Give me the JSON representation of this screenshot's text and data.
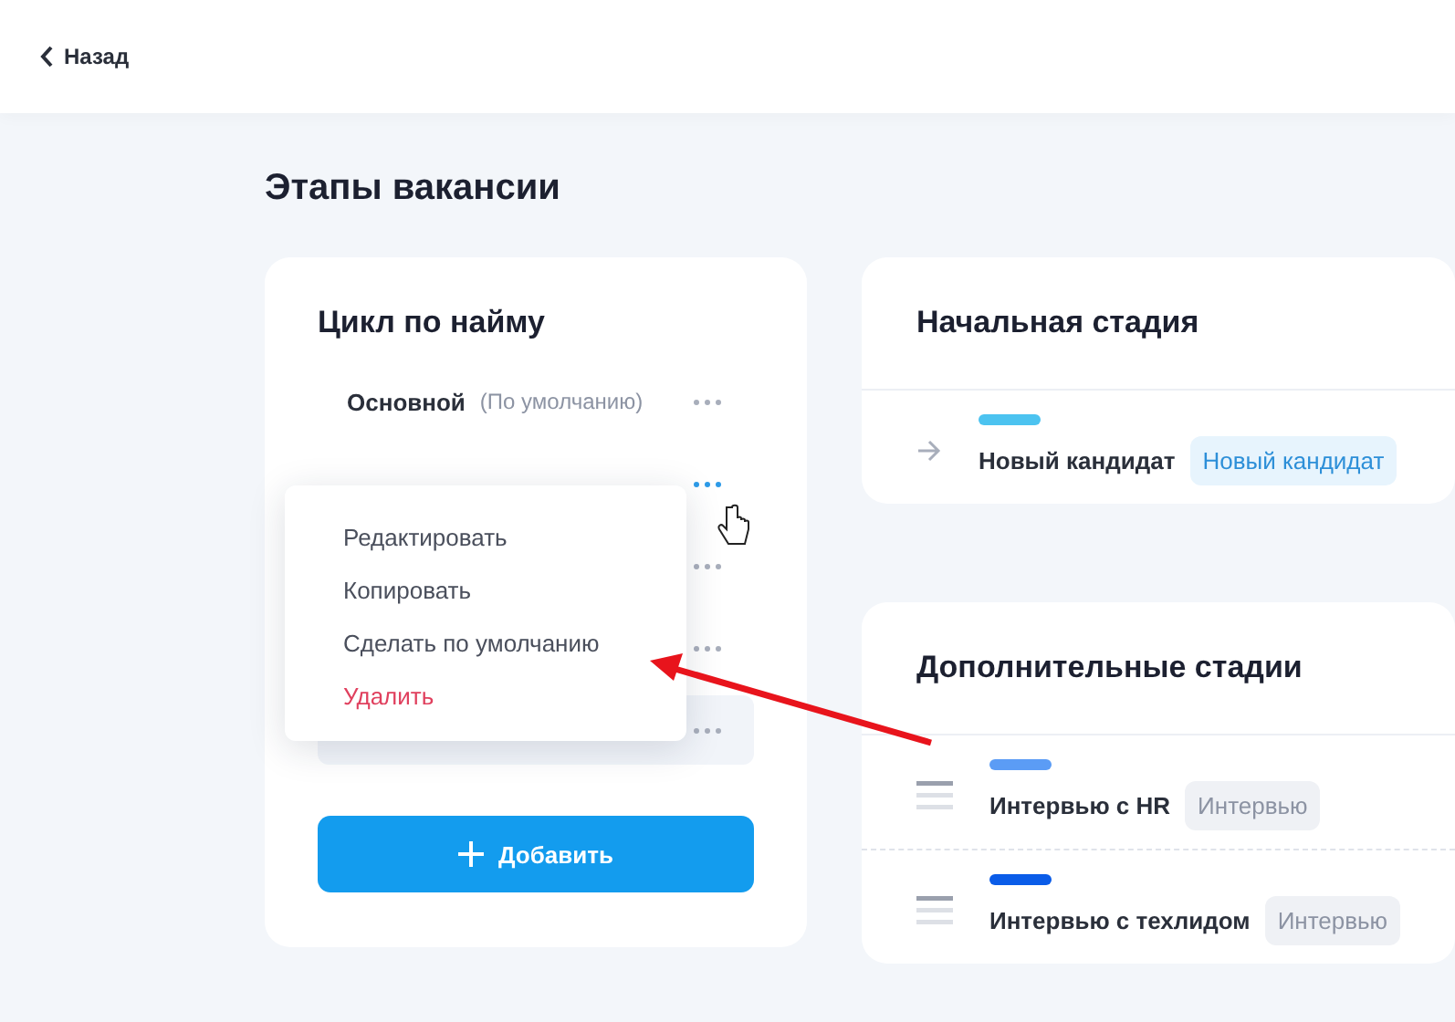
{
  "header": {
    "back_label": "Назад"
  },
  "page_title": "Этапы вакансии",
  "cycles_card": {
    "title": "Цикл по найму",
    "cycles": [
      {
        "name": "Основной",
        "note": "(По умолчанию)",
        "selected": false,
        "hovered": false
      },
      {
        "selected": false,
        "hovered": true
      },
      {
        "selected": false,
        "hovered": false
      },
      {
        "selected": false,
        "hovered": false
      },
      {
        "selected": true,
        "hovered": false
      }
    ],
    "add_button": "Добавить"
  },
  "context_menu": {
    "items": [
      {
        "label": "Редактировать",
        "kind": "normal"
      },
      {
        "label": "Копировать",
        "kind": "normal"
      },
      {
        "label": "Сделать по умолчанию",
        "kind": "normal"
      },
      {
        "label": "Удалить",
        "kind": "danger"
      }
    ]
  },
  "initial_stage": {
    "title": "Начальная стадия",
    "stages": [
      {
        "name": "Новый кандидат",
        "tag": "Новый кандидат",
        "color": "#4cc3f0",
        "kind": "accent"
      }
    ]
  },
  "extra_stages": {
    "title": "Дополнительные стадии",
    "stages": [
      {
        "name": "Интервью с HR",
        "tag": "Интервью",
        "color": "#5b9cf5",
        "kind": "neutral"
      },
      {
        "name": "Интервью с техлидом",
        "tag": "Интервью",
        "color": "#0a5ce8",
        "kind": "neutral"
      }
    ]
  }
}
